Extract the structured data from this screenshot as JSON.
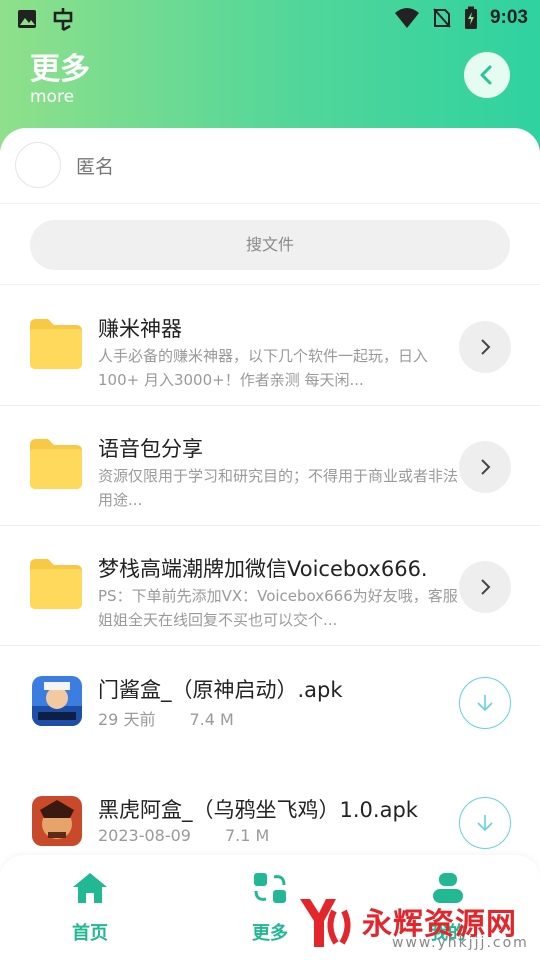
{
  "status_bar": {
    "time": "9:03",
    "icons": [
      "image-icon",
      "bug-icon",
      "wifi-icon",
      "no-sim-icon",
      "battery-charging-icon"
    ]
  },
  "header": {
    "title": "更多",
    "subtitle": "more",
    "back_icon": "chevron-left-icon"
  },
  "user": {
    "name": "匿名"
  },
  "search": {
    "placeholder": "搜文件"
  },
  "folders": [
    {
      "title": "赚米神器",
      "desc": "人手必备的赚米神器，以下几个软件一起玩，日入100+ 月入3000+！作者亲测 每天闲..."
    },
    {
      "title": "语音包分享",
      "desc": "资源仅限用于学习和研究目的；不得用于商业或者非法用途..."
    },
    {
      "title": "梦栈高端潮牌加微信Voicebox666.",
      "desc": "PS：下单前先添加VX：Voicebox666为好友哦，客服姐姐全天在线回复不买也可以交个..."
    }
  ],
  "files": [
    {
      "name": "门酱盒_（原神启动）.apk",
      "date": "29 天前",
      "size": "7.4 M",
      "icon": "genshin-app-icon"
    },
    {
      "name": "黑虎阿盒_（乌鸦坐飞鸡）1.0.apk",
      "date": "2023-08-09",
      "size": "7.1 M",
      "icon": "warrior-app-icon"
    }
  ],
  "tabs": [
    {
      "label": "首页",
      "icon": "home-icon"
    },
    {
      "label": "更多",
      "icon": "refresh-grid-icon"
    },
    {
      "label": "我的",
      "icon": "person-icon"
    }
  ],
  "watermark": {
    "text": "永辉资源网",
    "url": "www.yhkjjj.com"
  },
  "colors": {
    "accent": "#22b893",
    "header_start": "#8fe08a",
    "header_end": "#2fd2a0",
    "folder": "#ffd54f",
    "download_ring": "#62d3df",
    "watermark": "#e3262c"
  }
}
